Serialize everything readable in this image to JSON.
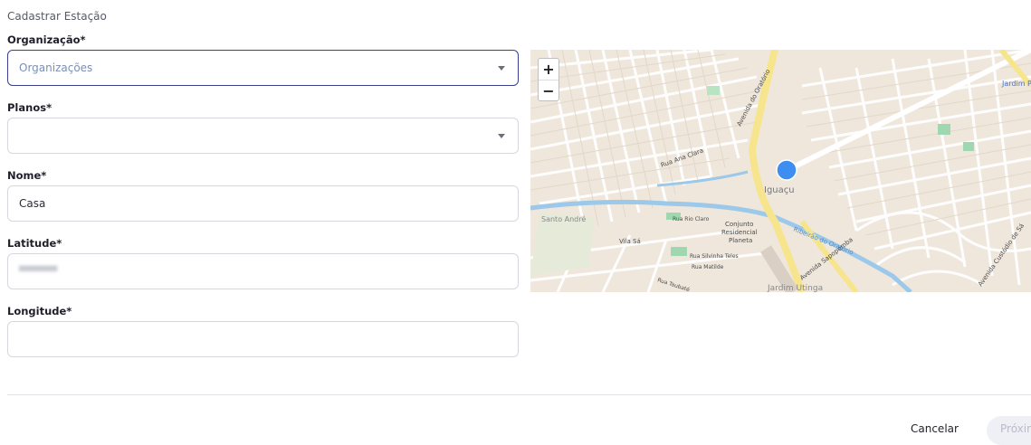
{
  "page": {
    "title": "Cadastrar Estação"
  },
  "form": {
    "organizacao": {
      "label": "Organização*",
      "placeholder": "Organizações"
    },
    "planos": {
      "label": "Planos*",
      "value": ""
    },
    "nome": {
      "label": "Nome*",
      "value": "Casa"
    },
    "latitude": {
      "label": "Latitude*"
    },
    "longitude": {
      "label": "Longitude*",
      "value": ""
    }
  },
  "map": {
    "zoom_in": "+",
    "zoom_out": "−",
    "labels": [
      "Avenida do Oratório",
      "Rua Ana Clara",
      "Iguaçu",
      "Conjunto",
      "Residencial",
      "Planeta",
      "Vila Sá",
      "Ribeirão do Oratório",
      "Jardim Planalto",
      "Santo André",
      "Jardim Utinga",
      "Rua Rio Claro",
      "Rua Silvinha Teles",
      "Rua Matilde",
      "Rua Taubaté",
      "Avenida Sapopemba",
      "Avenida Custódio de Sá"
    ],
    "colors": {
      "marker": "#3d8ef0",
      "river": "#9cc8ea",
      "road": "#ffffff",
      "main_road": "#f6e58d"
    }
  },
  "footer": {
    "cancel": "Cancelar",
    "next": "Próxim"
  }
}
